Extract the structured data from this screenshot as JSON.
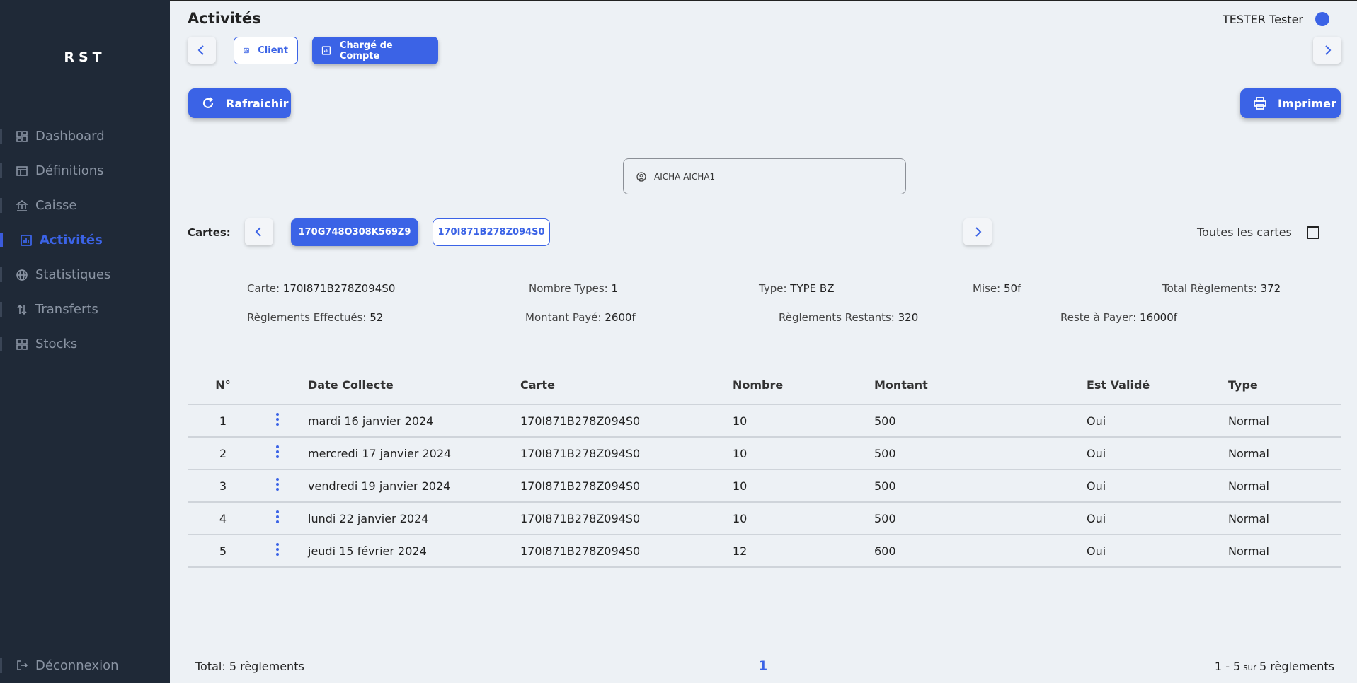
{
  "app": {
    "logo": "RST"
  },
  "sidebar": {
    "items": [
      {
        "label": "Dashboard",
        "icon": "dashboard-icon"
      },
      {
        "label": "Définitions",
        "icon": "table-icon"
      },
      {
        "label": "Caisse",
        "icon": "bank-icon"
      },
      {
        "label": "Activités",
        "icon": "bar-chart-icon",
        "active": true
      },
      {
        "label": "Statistiques",
        "icon": "globe-icon"
      },
      {
        "label": "Transferts",
        "icon": "transfer-icon"
      },
      {
        "label": "Stocks",
        "icon": "grid-icon"
      }
    ],
    "logout": "Déconnexion"
  },
  "header": {
    "title": "Activités",
    "user": "TESTER Tester"
  },
  "tabs": {
    "client": "Client",
    "charge": "Chargé de Compte"
  },
  "actions": {
    "refresh": "Rafraichir",
    "print": "Imprimer"
  },
  "client_select": {
    "value": "AICHA AICHA1"
  },
  "cartes": {
    "label": "Cartes:",
    "items": [
      "170G748O308K569Z9",
      "170I871B278Z094S0"
    ],
    "selected": 0,
    "all_label": "Toutes les cartes",
    "all_checked": false
  },
  "details": {
    "carte_label": "Carte:",
    "carte": "170I871B278Z094S0",
    "nb_types_label": "Nombre Types:",
    "nb_types": "1",
    "type_label": "Type:",
    "type": "TYPE BZ",
    "mise_label": "Mise:",
    "mise": "50f",
    "total_reg_label": "Total Règlements:",
    "total_reg": "372",
    "reg_eff_label": "Règlements Effectués:",
    "reg_eff": "52",
    "montant_paye_label": "Montant Payé:",
    "montant_paye": "2600f",
    "reg_rest_label": "Règlements Restants:",
    "reg_rest": "320",
    "reste_label": "Reste à Payer:",
    "reste": "16000f"
  },
  "table": {
    "headers": {
      "no": "N°",
      "date": "Date Collecte",
      "carte": "Carte",
      "nombre": "Nombre",
      "montant": "Montant",
      "valide": "Est Validé",
      "type": "Type"
    },
    "rows": [
      {
        "no": "1",
        "date": "mardi 16 janvier 2024",
        "carte": "170I871B278Z094S0",
        "nombre": "10",
        "montant": "500",
        "valide": "Oui",
        "type": "Normal"
      },
      {
        "no": "2",
        "date": "mercredi 17 janvier 2024",
        "carte": "170I871B278Z094S0",
        "nombre": "10",
        "montant": "500",
        "valide": "Oui",
        "type": "Normal"
      },
      {
        "no": "3",
        "date": "vendredi 19 janvier 2024",
        "carte": "170I871B278Z094S0",
        "nombre": "10",
        "montant": "500",
        "valide": "Oui",
        "type": "Normal"
      },
      {
        "no": "4",
        "date": "lundi 22 janvier 2024",
        "carte": "170I871B278Z094S0",
        "nombre": "10",
        "montant": "500",
        "valide": "Oui",
        "type": "Normal"
      },
      {
        "no": "5",
        "date": "jeudi 15 février 2024",
        "carte": "170I871B278Z094S0",
        "nombre": "12",
        "montant": "600",
        "valide": "Oui",
        "type": "Normal"
      }
    ]
  },
  "footer": {
    "total": "Total: 5 règlements",
    "page": "1",
    "range_start": "1 - 5",
    "range_sur": "sur",
    "range_end": "5 règlements"
  },
  "colors": {
    "primary": "#3b63e6",
    "sidebar": "#1f2937",
    "background": "#edf1f5"
  }
}
